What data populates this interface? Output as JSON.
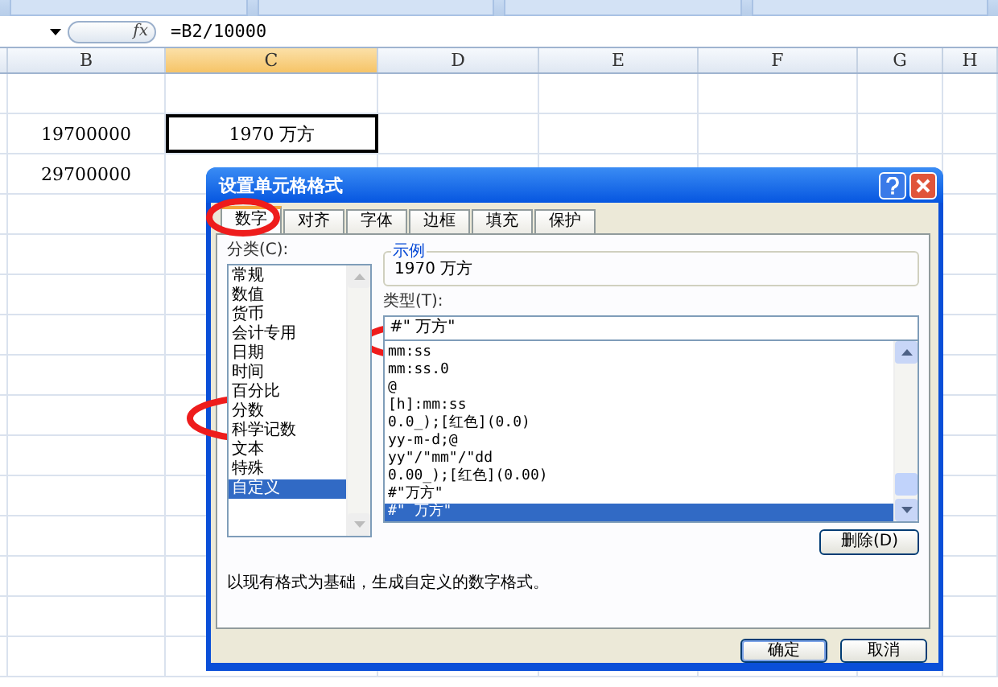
{
  "formula_bar": {
    "function_label": "fx",
    "formula": "=B2/10000"
  },
  "columns": [
    {
      "label": "B",
      "selected": false
    },
    {
      "label": "C",
      "selected": true
    },
    {
      "label": "D",
      "selected": false
    },
    {
      "label": "E",
      "selected": false
    },
    {
      "label": "F",
      "selected": false
    },
    {
      "label": "G",
      "selected": false
    },
    {
      "label": "H",
      "selected": false
    }
  ],
  "rows": [
    {
      "cells": [
        {
          "text": "19700000",
          "selected": false
        },
        {
          "text": "1970 万方",
          "selected": true
        }
      ]
    },
    {
      "cells": [
        {
          "text": "29700000",
          "selected": false
        }
      ]
    }
  ],
  "dialog": {
    "title": "设置单元格格式",
    "tabs": [
      {
        "label": "数字",
        "selected": true
      },
      {
        "label": "对齐",
        "selected": false
      },
      {
        "label": "字体",
        "selected": false
      },
      {
        "label": "边框",
        "selected": false
      },
      {
        "label": "填充",
        "selected": false
      },
      {
        "label": "保护",
        "selected": false
      }
    ],
    "category_label": "分类(C):",
    "categories": [
      {
        "label": "常规",
        "selected": false
      },
      {
        "label": "数值",
        "selected": false
      },
      {
        "label": "货币",
        "selected": false
      },
      {
        "label": "会计专用",
        "selected": false
      },
      {
        "label": "日期",
        "selected": false
      },
      {
        "label": "时间",
        "selected": false
      },
      {
        "label": "百分比",
        "selected": false
      },
      {
        "label": "分数",
        "selected": false
      },
      {
        "label": "科学记数",
        "selected": false
      },
      {
        "label": "文本",
        "selected": false
      },
      {
        "label": "特殊",
        "selected": false
      },
      {
        "label": "自定义",
        "selected": true
      }
    ],
    "sample": {
      "legend": "示例",
      "value": "1970 万方"
    },
    "type_label": "类型(T):",
    "type_value": "#\" 万方\"",
    "formats": [
      {
        "label": "mm:ss",
        "selected": false
      },
      {
        "label": "mm:ss.0",
        "selected": false
      },
      {
        "label": "@",
        "selected": false
      },
      {
        "label": "[h]:mm:ss",
        "selected": false
      },
      {
        "label": "0.0_);[红色](0.0)",
        "selected": false
      },
      {
        "label": "yy-m-d;@",
        "selected": false
      },
      {
        "label": "yy\"/\"mm\"/\"dd",
        "selected": false
      },
      {
        "label": "0.00_);[红色](0.00)",
        "selected": false
      },
      {
        "label": "#\"万方\"",
        "selected": false
      },
      {
        "label": "#\" 万方\"",
        "selected": true
      }
    ],
    "delete_button": "删除(D)",
    "description": "以现有格式为基础，生成自定义的数字格式。",
    "buttons": [
      "确定",
      "取消"
    ]
  }
}
